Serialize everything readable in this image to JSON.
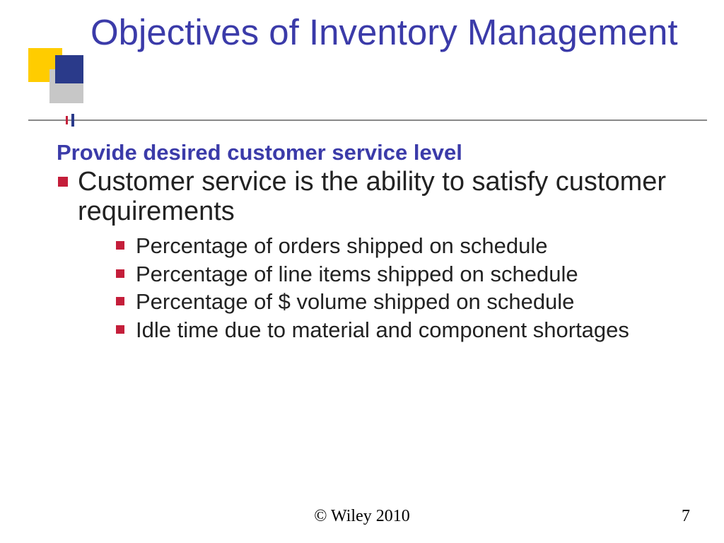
{
  "title": "Objectives of Inventory Management",
  "subhead": "Provide desired customer service level",
  "bullets": [
    {
      "text": "Customer service is the ability to satisfy customer requirements",
      "sub": [
        "Percentage of orders shipped on schedule",
        "Percentage of line items shipped on schedule",
        "Percentage of $ volume shipped on schedule",
        "Idle time due to material and component shortages"
      ]
    }
  ],
  "footer": {
    "copyright": "© Wiley 2010",
    "page": "7"
  },
  "colors": {
    "title": "#3b3ba9",
    "bullet": "#c41e3a",
    "logo_yellow": "#ffcc00",
    "logo_navy": "#2a3a8a",
    "logo_gray": "#c7c7c7"
  }
}
